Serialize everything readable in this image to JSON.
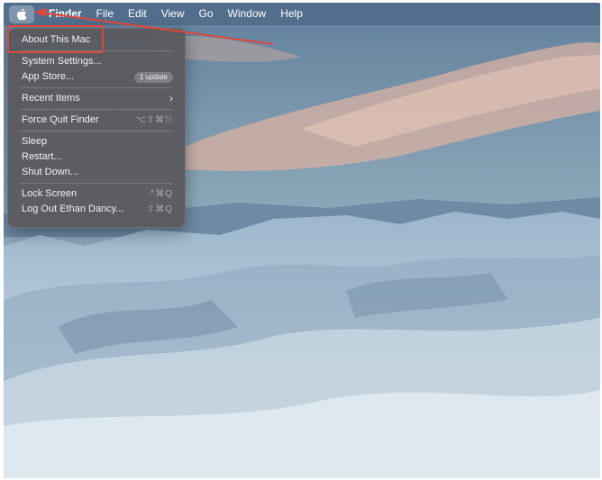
{
  "menubar": {
    "apple_icon": "apple-logo-icon",
    "items": [
      "Finder",
      "File",
      "Edit",
      "View",
      "Go",
      "Window",
      "Help"
    ]
  },
  "apple_menu": {
    "about": "About This Mac",
    "system_settings": "System Settings...",
    "app_store": "App Store...",
    "app_store_badge": "1 update",
    "recent_items": "Recent Items",
    "recent_items_chevron": "›",
    "force_quit": "Force Quit Finder",
    "force_quit_shortcut": "⌥⇧⌘⎋",
    "sleep": "Sleep",
    "restart": "Restart...",
    "shut_down": "Shut Down...",
    "lock_screen": "Lock Screen",
    "lock_screen_shortcut": "^⌘Q",
    "log_out": "Log Out Ethan Dancy...",
    "log_out_shortcut": "⇧⌘Q"
  },
  "colors": {
    "annotation": "#e0463a",
    "menubar": "#465f7d",
    "menu_bg": "#58585c"
  }
}
